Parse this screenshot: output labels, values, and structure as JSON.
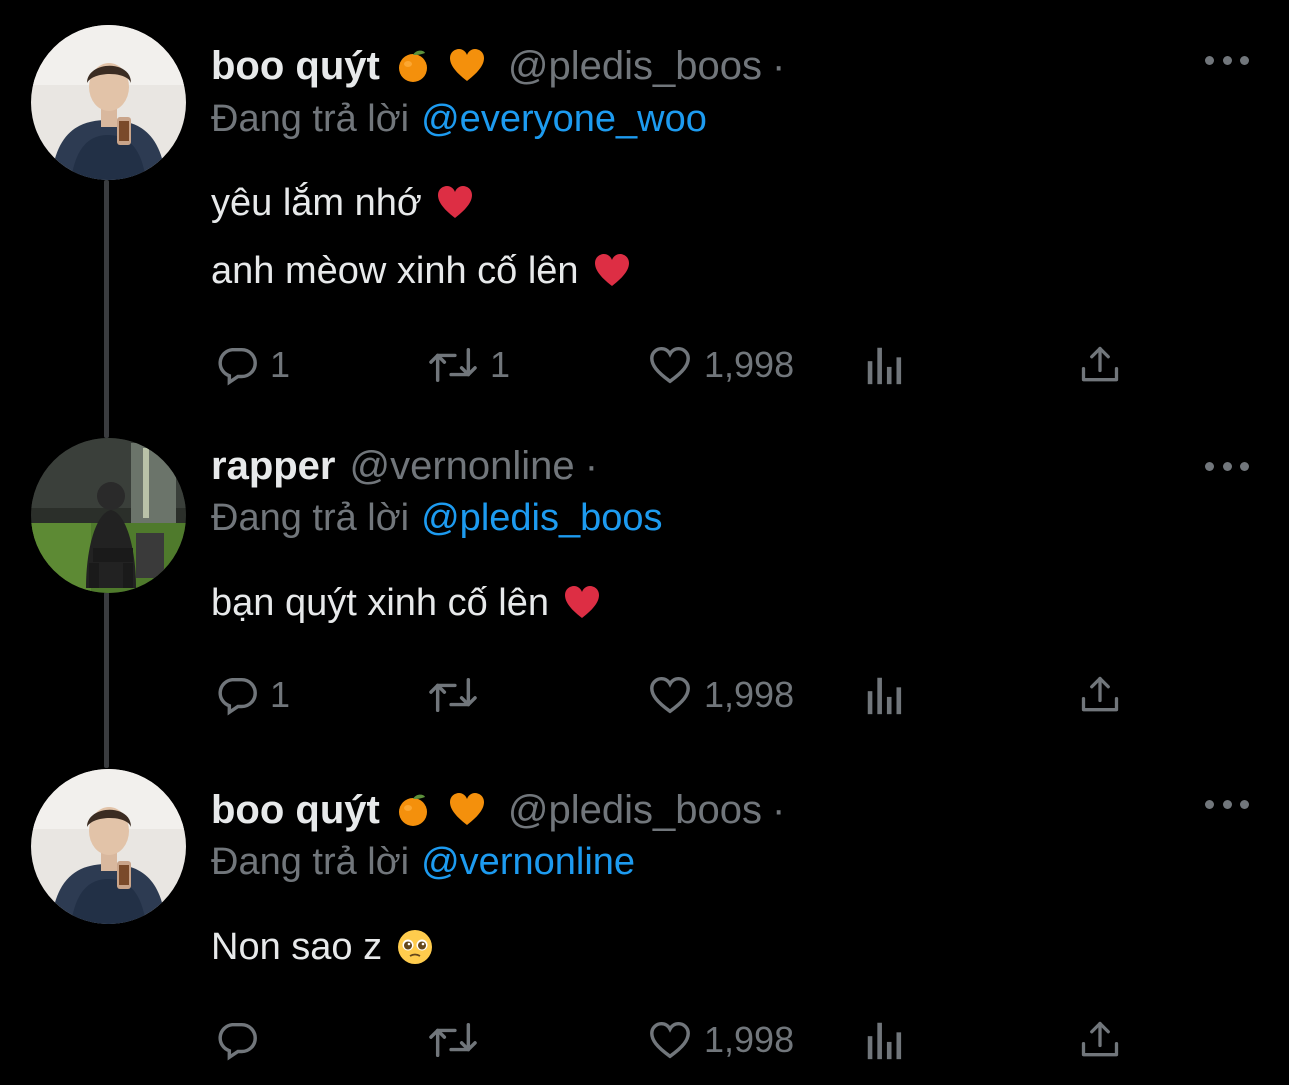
{
  "tweets": [
    {
      "name": "boo quýt",
      "name_emojis": [
        "tangerine-emoji",
        "orange-heart-emoji"
      ],
      "handle": "@pledis_boos",
      "separator": "·",
      "reply_prefix": "Đang trả lời",
      "reply_to": "@everyone_woo",
      "lines": [
        "yêu lắm nhớ",
        "anh mèow xinh cố lên"
      ],
      "line_emojis": [
        "red-heart-emoji",
        "red-heart-emoji"
      ],
      "replies": "1",
      "retweets": "1",
      "likes": "1,998",
      "views": ""
    },
    {
      "name": "rapper",
      "name_emojis": [],
      "handle": "@vernonline",
      "separator": "·",
      "reply_prefix": "Đang trả lời",
      "reply_to": "@pledis_boos",
      "lines": [
        "bạn quýt xinh cố lên"
      ],
      "line_emojis": [
        "red-heart-emoji"
      ],
      "replies": "1",
      "retweets": "",
      "likes": "1,998",
      "views": ""
    },
    {
      "name": "boo quýt",
      "name_emojis": [
        "tangerine-emoji",
        "orange-heart-emoji"
      ],
      "handle": "@pledis_boos",
      "separator": "·",
      "reply_prefix": "Đang trả lời",
      "reply_to": "@vernonline",
      "lines": [
        "Non sao z"
      ],
      "line_emojis": [
        "pleading-face-emoji"
      ],
      "replies": "",
      "retweets": "",
      "likes": "1,998",
      "views": ""
    }
  ],
  "colors": {
    "background": "#000000",
    "text": "#e7e9ea",
    "secondary": "#71767b",
    "link": "#1d9bf0",
    "thread_line": "#3a3c3f"
  }
}
